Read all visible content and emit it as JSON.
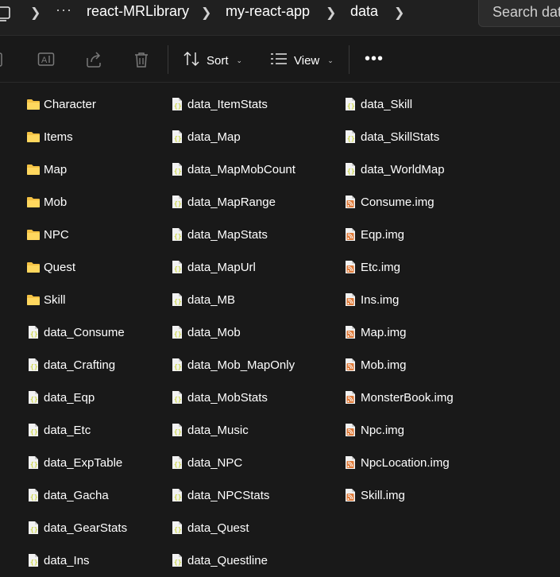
{
  "breadcrumb": {
    "items": [
      "react-MRLibrary",
      "my-react-app",
      "data"
    ]
  },
  "search": {
    "placeholder": "Search data"
  },
  "toolbar": {
    "sort_label": "Sort",
    "view_label": "View"
  },
  "files": {
    "col1": [
      {
        "name": "Character",
        "type": "folder"
      },
      {
        "name": "Items",
        "type": "folder"
      },
      {
        "name": "Map",
        "type": "folder"
      },
      {
        "name": "Mob",
        "type": "folder"
      },
      {
        "name": "NPC",
        "type": "folder"
      },
      {
        "name": "Quest",
        "type": "folder"
      },
      {
        "name": "Skill",
        "type": "folder"
      },
      {
        "name": "data_Consume",
        "type": "json"
      },
      {
        "name": "data_Crafting",
        "type": "json"
      },
      {
        "name": "data_Eqp",
        "type": "json"
      },
      {
        "name": "data_Etc",
        "type": "json"
      },
      {
        "name": "data_ExpTable",
        "type": "json"
      },
      {
        "name": "data_Gacha",
        "type": "json"
      },
      {
        "name": "data_GearStats",
        "type": "json"
      },
      {
        "name": "data_Ins",
        "type": "json"
      }
    ],
    "col2": [
      {
        "name": "data_ItemStats",
        "type": "json"
      },
      {
        "name": "data_Map",
        "type": "json"
      },
      {
        "name": "data_MapMobCount",
        "type": "json"
      },
      {
        "name": "data_MapRange",
        "type": "json"
      },
      {
        "name": "data_MapStats",
        "type": "json"
      },
      {
        "name": "data_MapUrl",
        "type": "json"
      },
      {
        "name": "data_MB",
        "type": "json"
      },
      {
        "name": "data_Mob",
        "type": "json"
      },
      {
        "name": "data_Mob_MapOnly",
        "type": "json"
      },
      {
        "name": "data_MobStats",
        "type": "json"
      },
      {
        "name": "data_Music",
        "type": "json"
      },
      {
        "name": "data_NPC",
        "type": "json"
      },
      {
        "name": "data_NPCStats",
        "type": "json"
      },
      {
        "name": "data_Quest",
        "type": "json"
      },
      {
        "name": "data_Questline",
        "type": "json"
      }
    ],
    "col3": [
      {
        "name": "data_Skill",
        "type": "json"
      },
      {
        "name": "data_SkillStats",
        "type": "json"
      },
      {
        "name": "data_WorldMap",
        "type": "json"
      },
      {
        "name": "Consume.img",
        "type": "img"
      },
      {
        "name": "Eqp.img",
        "type": "img"
      },
      {
        "name": "Etc.img",
        "type": "img"
      },
      {
        "name": "Ins.img",
        "type": "img"
      },
      {
        "name": "Map.img",
        "type": "img"
      },
      {
        "name": "Mob.img",
        "type": "img"
      },
      {
        "name": "MonsterBook.img",
        "type": "img"
      },
      {
        "name": "Npc.img",
        "type": "img"
      },
      {
        "name": "NpcLocation.img",
        "type": "img"
      },
      {
        "name": "Skill.img",
        "type": "img"
      }
    ]
  },
  "icons": {
    "folder": "folder-icon",
    "json": "json-file-icon",
    "img": "feed-file-icon"
  },
  "colors": {
    "folder": "#f3c144",
    "json_accent": "#cfd84a",
    "img_accent": "#e07b39"
  }
}
